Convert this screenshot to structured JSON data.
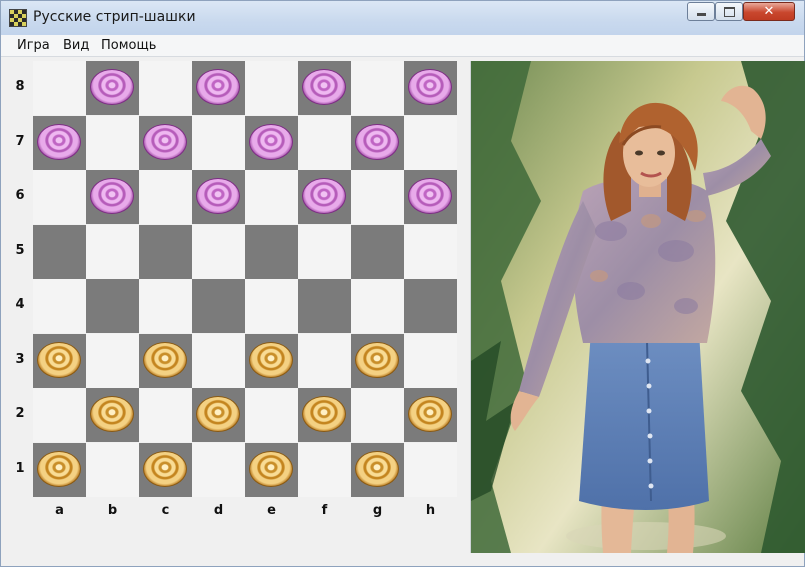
{
  "window": {
    "title": "Русские стрип-шашки",
    "icon": "checkerboard-icon"
  },
  "window_controls": {
    "minimize": "minimize-icon",
    "maximize": "maximize-icon",
    "close": "close-icon",
    "close_glyph": "✕"
  },
  "menu": [
    "Игра",
    "Вид",
    "Помощь"
  ],
  "board": {
    "files": [
      "a",
      "b",
      "c",
      "d",
      "e",
      "f",
      "g",
      "h"
    ],
    "ranks": [
      "8",
      "7",
      "6",
      "5",
      "4",
      "3",
      "2",
      "1"
    ],
    "colors": {
      "light": "#f4f4f4",
      "dark": "#7b7b7b",
      "pink_piece": "#d98bdc",
      "gold_piece": "#e8b85a"
    },
    "pieces": {
      "b8": "pink",
      "d8": "pink",
      "f8": "pink",
      "h8": "pink",
      "a7": "pink",
      "c7": "pink",
      "e7": "pink",
      "g7": "pink",
      "b6": "pink",
      "d6": "pink",
      "f6": "pink",
      "h6": "pink",
      "a3": "gold",
      "c3": "gold",
      "e3": "gold",
      "g3": "gold",
      "b2": "gold",
      "d2": "gold",
      "f2": "gold",
      "h2": "gold",
      "a1": "gold",
      "c1": "gold",
      "e1": "gold",
      "g1": "gold"
    }
  },
  "side_image": {
    "subject": "woman-portrait-photo"
  }
}
